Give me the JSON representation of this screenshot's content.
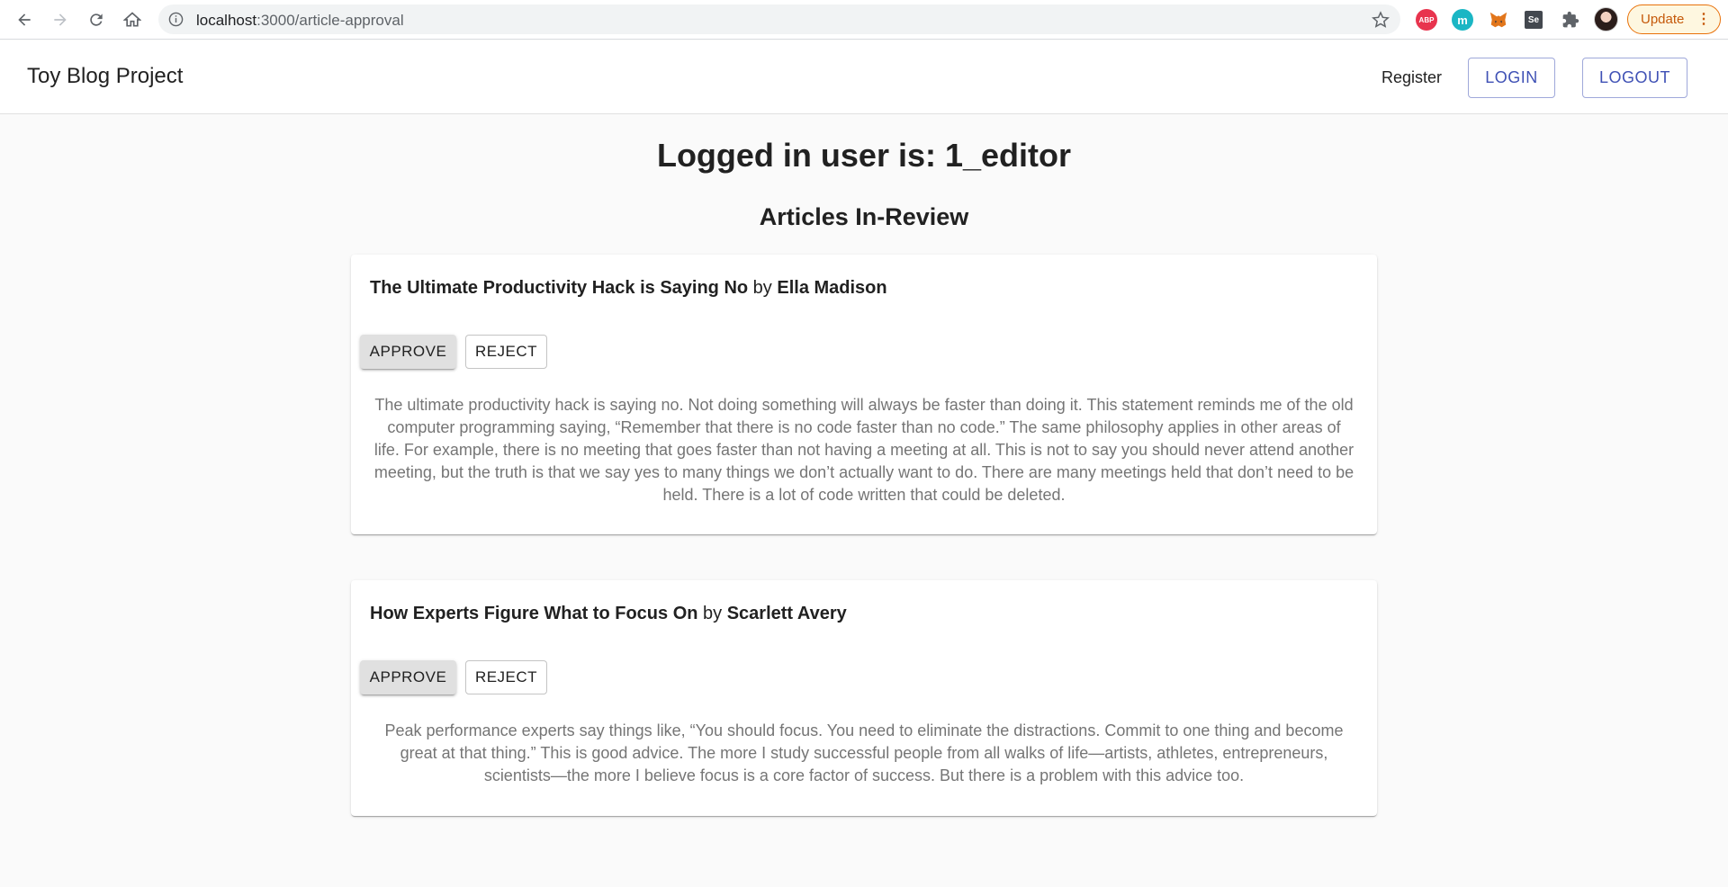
{
  "browser": {
    "url_host": "localhost",
    "url_path": ":3000/article-approval",
    "update_label": "Update",
    "extensions": [
      "abp-icon",
      "m-icon",
      "metamask-icon",
      "selenium-icon",
      "puzzle-icon"
    ],
    "ext_abp_text": "ABP",
    "ext_m_text": "m",
    "ext_se_text": "Se"
  },
  "app_bar": {
    "title": "Toy Blog Project",
    "register_label": "Register",
    "login_label": "LOGIN",
    "logout_label": "LOGOUT",
    "accent_color": "#3f51b5"
  },
  "main": {
    "user_heading": "Logged in user is: 1_editor",
    "section_heading": "Articles In-Review",
    "articles": [
      {
        "title": "The Ultimate Productivity Hack is Saying No",
        "by": "by",
        "author": "Ella Madison",
        "approve_label": "APPROVE",
        "reject_label": "REJECT",
        "body": "The ultimate productivity hack is saying no. Not doing something will always be faster than doing it. This statement reminds me of the old computer programming saying, “Remember that there is no code faster than no code.” The same philosophy applies in other areas of life. For example, there is no meeting that goes faster than not having a meeting at all. This is not to say you should never attend another meeting, but the truth is that we say yes to many things we don’t actually want to do. There are many meetings held that don’t need to be held. There is a lot of code written that could be deleted."
      },
      {
        "title": "How Experts Figure What to Focus On",
        "by": "by",
        "author": "Scarlett Avery",
        "approve_label": "APPROVE",
        "reject_label": "REJECT",
        "body": "Peak performance experts say things like, “You should focus. You need to eliminate the distractions. Commit to one thing and become great at that thing.” This is good advice. The more I study successful people from all walks of life—artists, athletes, entrepreneurs, scientists—the more I believe focus is a core factor of success. But there is a problem with this advice too."
      }
    ]
  }
}
